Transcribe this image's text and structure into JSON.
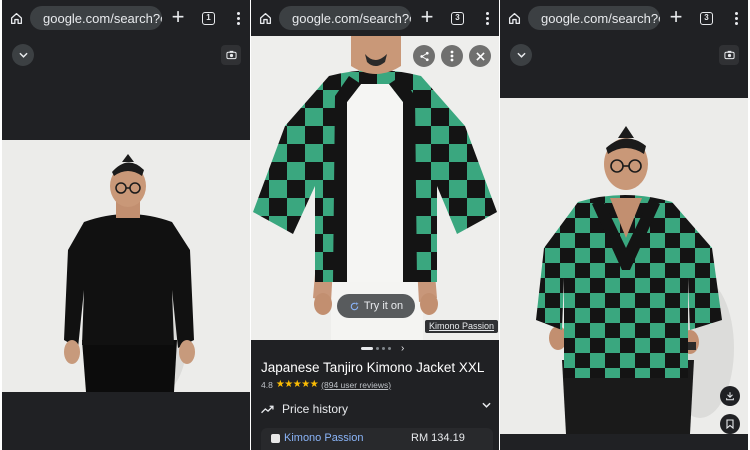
{
  "browser": {
    "url_display": "google.com/search?c",
    "new_tab_label": "+",
    "tab_counts": [
      "1",
      "3",
      "3"
    ]
  },
  "product": {
    "title": "Japanese Tanjiro Kimono Jacket XXL",
    "rating": "4.8",
    "stars": "★★★★★",
    "reviews": "(894 user reviews)",
    "try_it_on": "Try it on",
    "source_badge": "Kimono Passion",
    "carousel_next": "›",
    "price_history_label": "Price history",
    "seller": {
      "name": "Kimono Passion",
      "price": "RM 134.19"
    }
  },
  "colors": {
    "chrome_dark": "#202124",
    "url_pill": "#3c4043",
    "kimono_green": "#3aa77f",
    "kimono_black": "#141414",
    "star_yellow": "#fbbc04",
    "link_blue": "#8ab4f8"
  },
  "icons": {
    "home": "home-icon",
    "site_settings": "tune-icon",
    "tab_switcher": "tab-switcher-icon",
    "menu": "more-vert-icon",
    "collapse": "chevron-down-icon",
    "visual_search": "camera-search-icon",
    "share": "share-icon",
    "more": "more-vert-icon",
    "close": "close-icon",
    "try_on": "sparkle-refresh-icon",
    "trend": "trending-icon",
    "expand": "chevron-down-icon",
    "download": "download-icon",
    "save": "bookmark-icon"
  }
}
